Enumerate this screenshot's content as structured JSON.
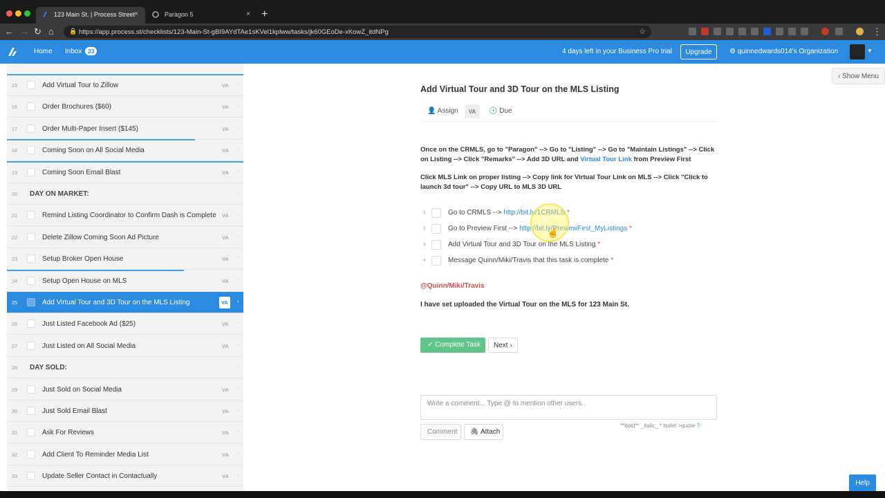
{
  "browser": {
    "tabs": [
      {
        "title": "123 Main St. | Process Street",
        "active": true
      },
      {
        "title": "Paragon 5",
        "active": false
      }
    ],
    "url": "https://app.process.st/checklists/123-Main-St-gBI9AYdTAe1sKVel1kplww/tasks/jk60GEoDe-xKowZ_itdNPg",
    "new_tab_symbol": "+",
    "close_symbol": "×"
  },
  "header": {
    "home": "Home",
    "inbox": "Inbox",
    "inbox_count": "23",
    "trial": "4 days left in your Business Pro trial",
    "upgrade": "Upgrade",
    "org": "quinnedwards014's Organization",
    "accent_color": "#2c8ae0"
  },
  "sidebar": {
    "rows": [
      {
        "num": "15",
        "label": "Add Virtual Tour to Zillow",
        "va": "VA"
      },
      {
        "num": "16",
        "label": "Order Brochures ($60)",
        "va": "VA"
      },
      {
        "num": "17",
        "label": "Order Multi-Paper Insert ($145)",
        "va": "VA"
      },
      {
        "num": "18",
        "label": "Coming Soon on All Social Media",
        "va": "VA"
      },
      {
        "num": "19",
        "label": "Coming Soon Email Blast",
        "va": "VA"
      },
      {
        "num": "20",
        "label": "DAY ON MARKET:",
        "heading": true
      },
      {
        "num": "21",
        "label": "Remind Listing Coordinator to Confirm Dash is Complete",
        "va": "VA"
      },
      {
        "num": "22",
        "label": "Delete Zillow Coming Soon Ad Picture",
        "va": "VA"
      },
      {
        "num": "23",
        "label": "Setup Broker Open House",
        "va": "VA"
      },
      {
        "num": "24",
        "label": "Setup Open House on MLS",
        "va": "VA"
      },
      {
        "num": "25",
        "label": "Add Virtual Tour and 3D Tour on the MLS Listing",
        "va": "VA",
        "active": true
      },
      {
        "num": "26",
        "label": "Just Listed Facebook Ad ($25)",
        "va": "VA"
      },
      {
        "num": "27",
        "label": "Just Listed on All Social Media",
        "va": "VA"
      },
      {
        "num": "28",
        "label": "DAY SOLD:",
        "heading": true
      },
      {
        "num": "29",
        "label": "Just Sold on Social Media",
        "va": "VA"
      },
      {
        "num": "30",
        "label": "Just Sold Email Blast",
        "va": "VA"
      },
      {
        "num": "31",
        "label": "Ask For Reviews",
        "va": "VA"
      },
      {
        "num": "32",
        "label": "Add Client To Reminder Media List",
        "va": "VA"
      },
      {
        "num": "33",
        "label": "Update Seller Contact in Contactually",
        "va": "VA"
      }
    ]
  },
  "main": {
    "show_menu": "Show Menu",
    "title": "Add Virtual Tour and 3D Tour on the MLS Listing",
    "assign": "Assign",
    "assignee": "VA",
    "due": "Due",
    "para1_a": "Once on the CRMLS, go to \"Paragon\" --> Go to \"Listing\" --> Go to \"Maintain Listings\" --> Click on Listing --> Click \"Remarks\" --> Add 3D URL and ",
    "para1_link": "Virtual Tour Link",
    "para1_b": " from Preview First",
    "para2": "Click MLS Link on proper listing --> Copy link for Virtual Tour Link on MLS --> Click \"Click to launch 3d tour\" --> Copy URL to MLS 3D URL",
    "checklist": [
      {
        "n": "1",
        "text": "Go to CRMLS --> ",
        "link": "http://bit.ly/1CRMLS",
        "req": "*"
      },
      {
        "n": "2",
        "text": "Go to Preview First --> ",
        "link": "http://bit.ly/PreviewFirst_MyListings",
        "req": "*"
      },
      {
        "n": "3",
        "text": "Add Virtual Tour and 3D Tour on the MLS Listing ",
        "link": "",
        "req": "*"
      },
      {
        "n": "4",
        "text": "Message Quinn/Miki/Travis that this task is complete ",
        "link": "",
        "req": "*"
      }
    ],
    "mention": "@Quinn/Miki/Travis",
    "summary": "I have set uploaded the Virtual Tour on the MLS for 123 Main St.",
    "complete": "✓ Complete Task",
    "next": "Next",
    "comment_placeholder": "Write a comment... Type @ to mention other users.",
    "format_hint": "**bold**  _italic_  * bullet  >quote",
    "format_help": "?",
    "comment_btn": "Comment",
    "attach_btn": "Attach",
    "help": "Help"
  }
}
